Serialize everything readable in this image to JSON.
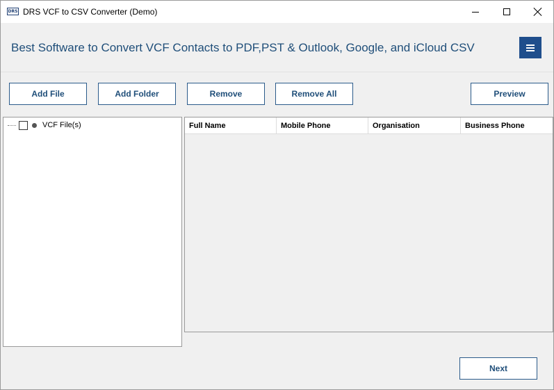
{
  "window": {
    "title": "DRS VCF to CSV Converter (Demo)",
    "app_icon_text": "DRS"
  },
  "banner": {
    "title": "Best Software to Convert VCF Contacts to PDF,PST & Outlook, Google, and iCloud CSV"
  },
  "toolbar": {
    "add_file_label": "Add File",
    "add_folder_label": "Add Folder",
    "remove_label": "Remove",
    "remove_all_label": "Remove All",
    "preview_label": "Preview"
  },
  "tree": {
    "root_label": "VCF File(s)",
    "root_checked": false
  },
  "grid": {
    "columns": [
      "Full Name",
      "Mobile Phone",
      "Organisation",
      "Business Phone"
    ],
    "rows": []
  },
  "footer": {
    "next_label": "Next"
  },
  "icons": {
    "app": "drs-logo-icon",
    "minimize": "minimize-icon",
    "maximize": "maximize-icon",
    "close": "close-icon",
    "menu": "hamburger-menu-icon"
  },
  "colors": {
    "accent": "#1f4e8c",
    "banner_text": "#1f4e79",
    "button_border": "#2a5a8a",
    "background": "#f0f0f0"
  }
}
